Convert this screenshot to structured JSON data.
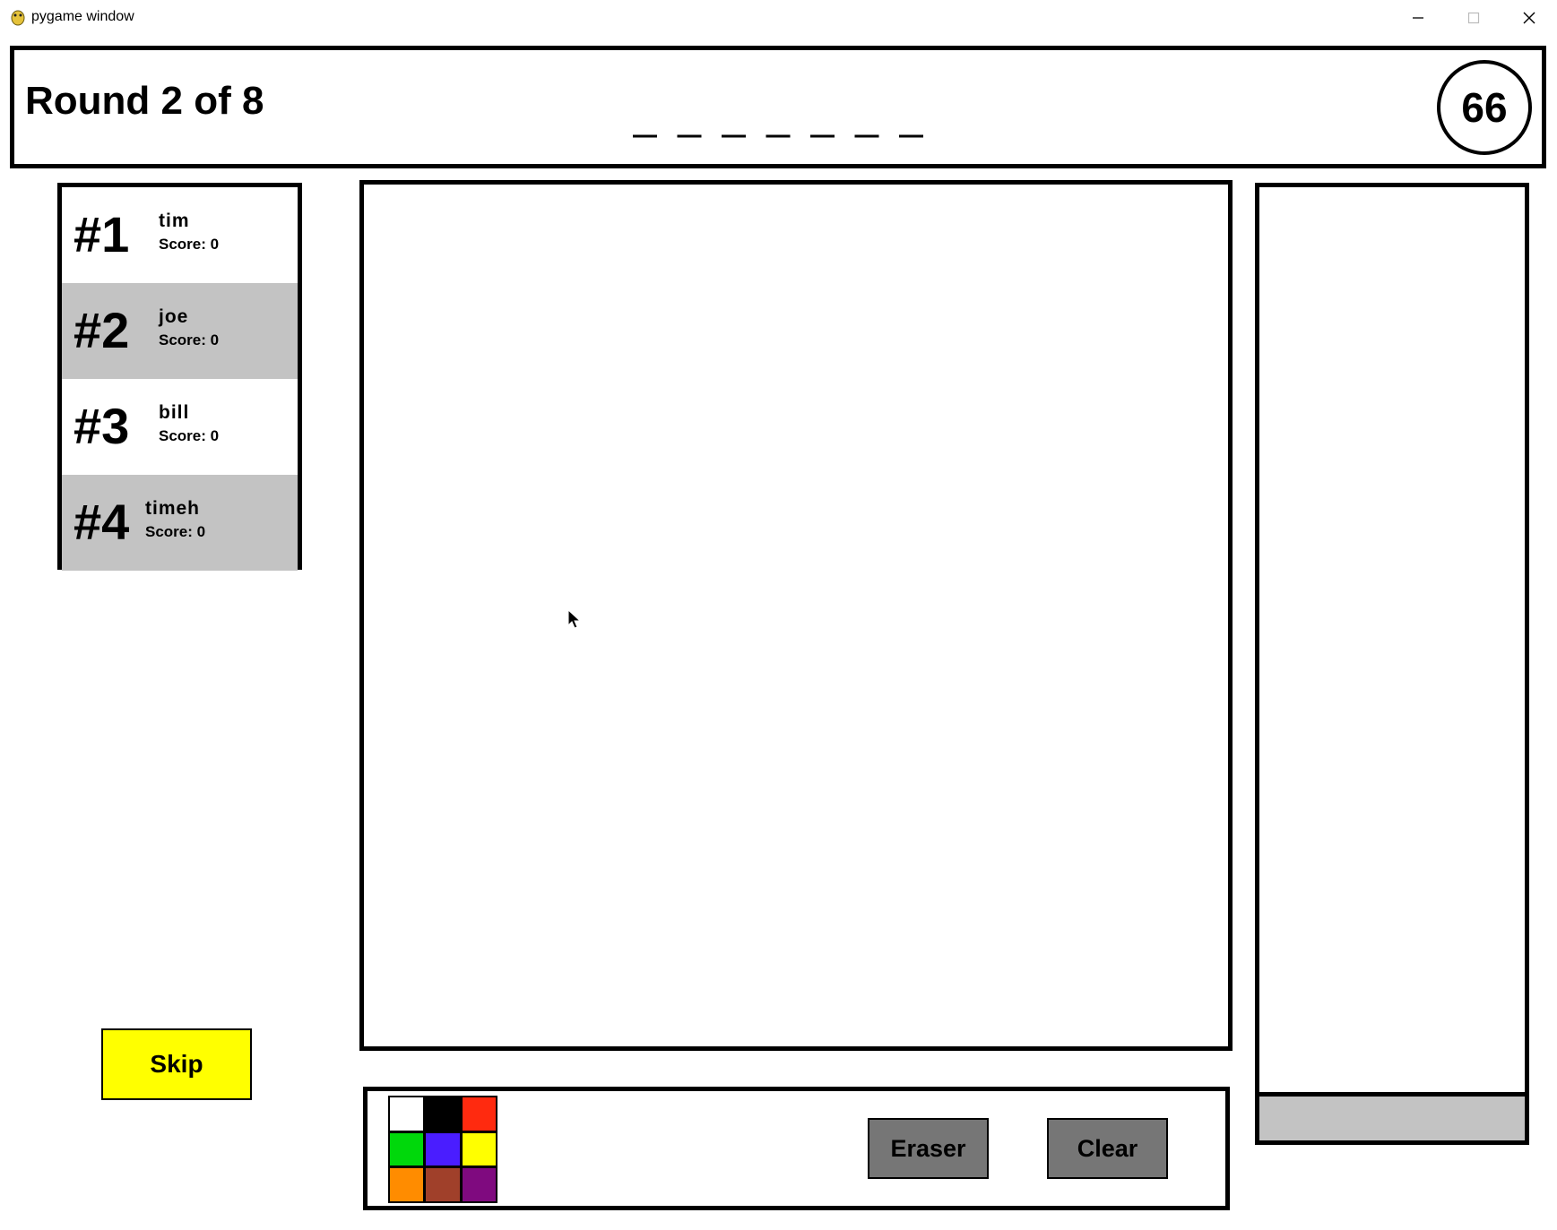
{
  "window": {
    "title": "pygame window",
    "controls": [
      "minimize-icon",
      "maximize-icon",
      "close-icon"
    ]
  },
  "header": {
    "round_label": "Round 2 of 8",
    "word_blanks": 7,
    "timer": "66"
  },
  "leaderboard": {
    "players": [
      {
        "rank": "#1",
        "name": "tim",
        "score": "Score: 0",
        "highlight": false
      },
      {
        "rank": "#2",
        "name": "joe",
        "score": "Score: 0",
        "highlight": true
      },
      {
        "rank": "#3",
        "name": "bill",
        "score": "Score: 0",
        "highlight": false
      },
      {
        "rank": "#4",
        "name": "timeh",
        "score": "Score: 0",
        "highlight": true
      }
    ]
  },
  "controls": {
    "skip_label": "Skip",
    "eraser_label": "Eraser",
    "clear_label": "Clear"
  },
  "palette": {
    "colors": [
      "#ffffff",
      "#000000",
      "#ff2a0f",
      "#00d80b",
      "#4a1dff",
      "#ffff00",
      "#ff8c00",
      "#a0402a",
      "#7f0a7f"
    ]
  },
  "colors": {
    "skip": "#ffff00",
    "tool_button": "#767676",
    "row_alt": "#c3c3c3"
  }
}
